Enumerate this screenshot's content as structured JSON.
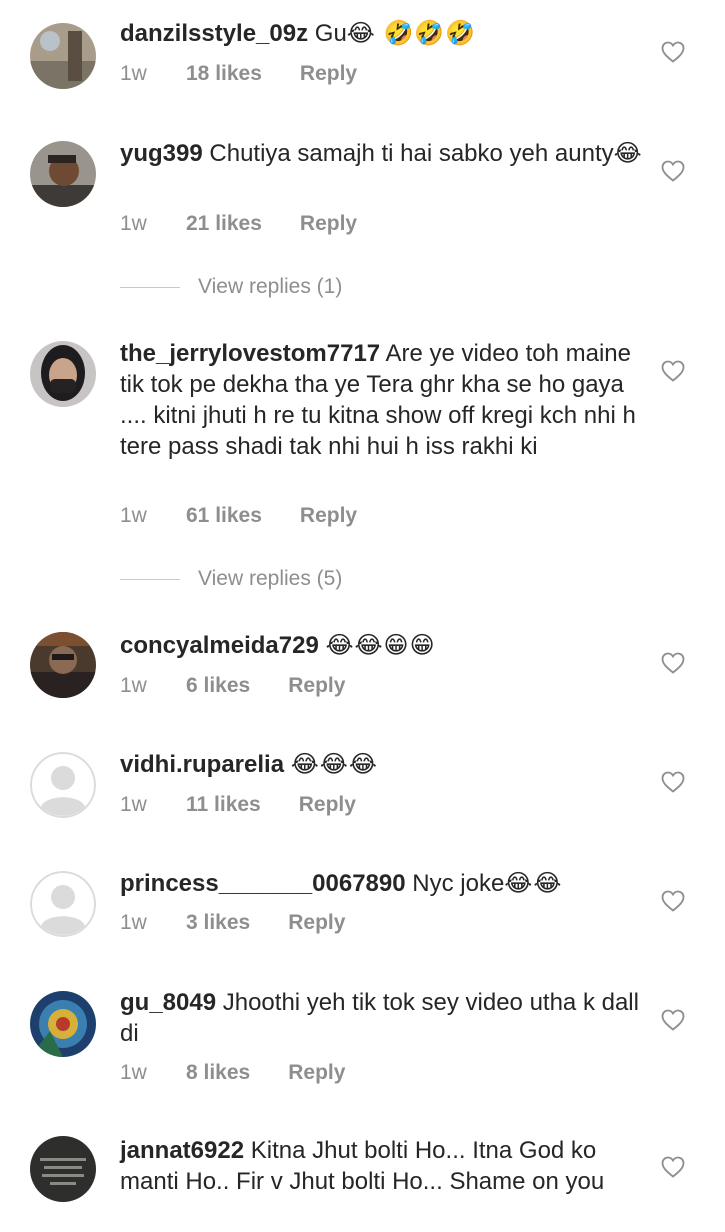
{
  "comments": [
    {
      "username": "danzilsstyle_09z",
      "text": "Gu",
      "emoji": "😂 🤣🤣🤣",
      "time": "1w",
      "likes": "18 likes",
      "reply": "Reply"
    },
    {
      "username": "yug399",
      "text": "Chutiya samajh ti hai sabko yeh aunty",
      "emoji": "😂",
      "time": "1w",
      "likes": "21 likes",
      "reply": "Reply",
      "view_replies": "View replies (1)"
    },
    {
      "username": "the_jerrylovestom7717",
      "text": "Are ye video toh maine tik tok pe dekha tha ye Tera ghr kha se ho gaya .... kitni jhuti h re tu kitna show off kregi kch nhi h tere pass shadi tak nhi hui h iss rakhi ki",
      "emoji": "",
      "time": "1w",
      "likes": "61 likes",
      "reply": "Reply",
      "view_replies": "View replies (5)"
    },
    {
      "username": "concyalmeida729",
      "text": "",
      "emoji": "😂😂😁😁",
      "time": "1w",
      "likes": "6 likes",
      "reply": "Reply"
    },
    {
      "username": "vidhi.ruparelia",
      "text": "",
      "emoji": "😂😂😂",
      "time": "1w",
      "likes": "11 likes",
      "reply": "Reply"
    },
    {
      "username": "princess_______0067890",
      "text": "Nyc joke",
      "emoji": "😂😂",
      "time": "1w",
      "likes": "3 likes",
      "reply": "Reply"
    },
    {
      "username": "gu_8049",
      "text": "Jhoothi yeh tik tok sey video utha k dall di",
      "emoji": "",
      "time": "1w",
      "likes": "8 likes",
      "reply": "Reply"
    },
    {
      "username": "jannat6922",
      "text": "Kitna Jhut bolti Ho... Itna God ko manti Ho.. Fir v Jhut bolti Ho... Shame on you",
      "emoji": "",
      "time": "",
      "likes": "",
      "reply": ""
    }
  ],
  "icons": {
    "like": "heart-outline-icon",
    "avatar_default": "default-avatar-icon"
  },
  "colors": {
    "text": "#262626",
    "secondary": "#8e8e8e",
    "divider": "#c7c7c7"
  }
}
